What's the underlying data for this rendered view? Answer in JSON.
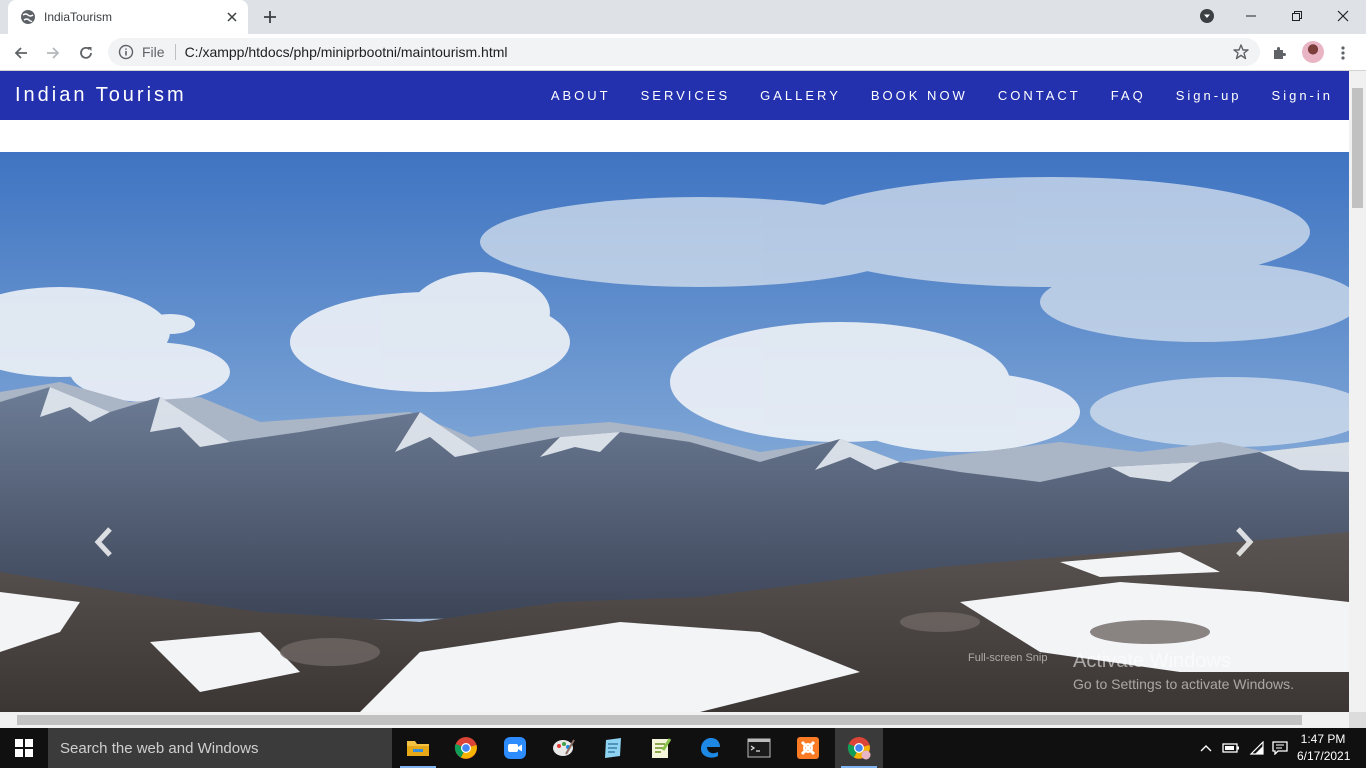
{
  "browser": {
    "tab_title": "IndiaTourism",
    "address_scheme": "File",
    "address_url": "C:/xampp/htdocs/php/miniprbootni/maintourism.html",
    "icons": {
      "favicon": "globe-icon",
      "close_tab": "close-icon",
      "new_tab": "plus-icon",
      "media": "media-control-icon",
      "minimize": "minimize-icon",
      "restore": "restore-icon",
      "close_window": "close-icon",
      "back": "arrow-left-icon",
      "forward": "arrow-right-icon",
      "reload": "reload-icon",
      "site_info": "info-icon",
      "bookmark": "star-icon",
      "extensions": "puzzle-icon",
      "menu": "kebab-menu-icon"
    }
  },
  "site": {
    "brand": "Indian Tourism",
    "nav": [
      "ABOUT",
      "SERVICES",
      "GALLERY",
      "BOOK NOW",
      "CONTACT",
      "FAQ",
      "Sign-up",
      "Sign-in"
    ],
    "nav_color": "#2331ae"
  },
  "carousel": {
    "prev_icon": "chevron-left-icon",
    "next_icon": "chevron-right-icon",
    "image": "snowy-mountain-range-landscape"
  },
  "watermark": {
    "snip": "Full-screen Snip",
    "title": "Activate Windows",
    "subtitle": "Go to Settings to activate Windows."
  },
  "taskbar": {
    "search_placeholder": "Search the web and Windows",
    "time": "1:47 PM",
    "date": "6/17/2021",
    "apps": [
      "file-explorer-icon",
      "chrome-icon",
      "zoom-icon",
      "paint-icon",
      "notepad-icon",
      "notepad-plus-plus-icon",
      "edge-icon",
      "command-prompt-icon",
      "xampp-icon",
      "chrome-profile-icon"
    ],
    "tray": [
      "chevron-up-icon",
      "battery-icon",
      "wifi-icon",
      "notification-icon"
    ]
  }
}
